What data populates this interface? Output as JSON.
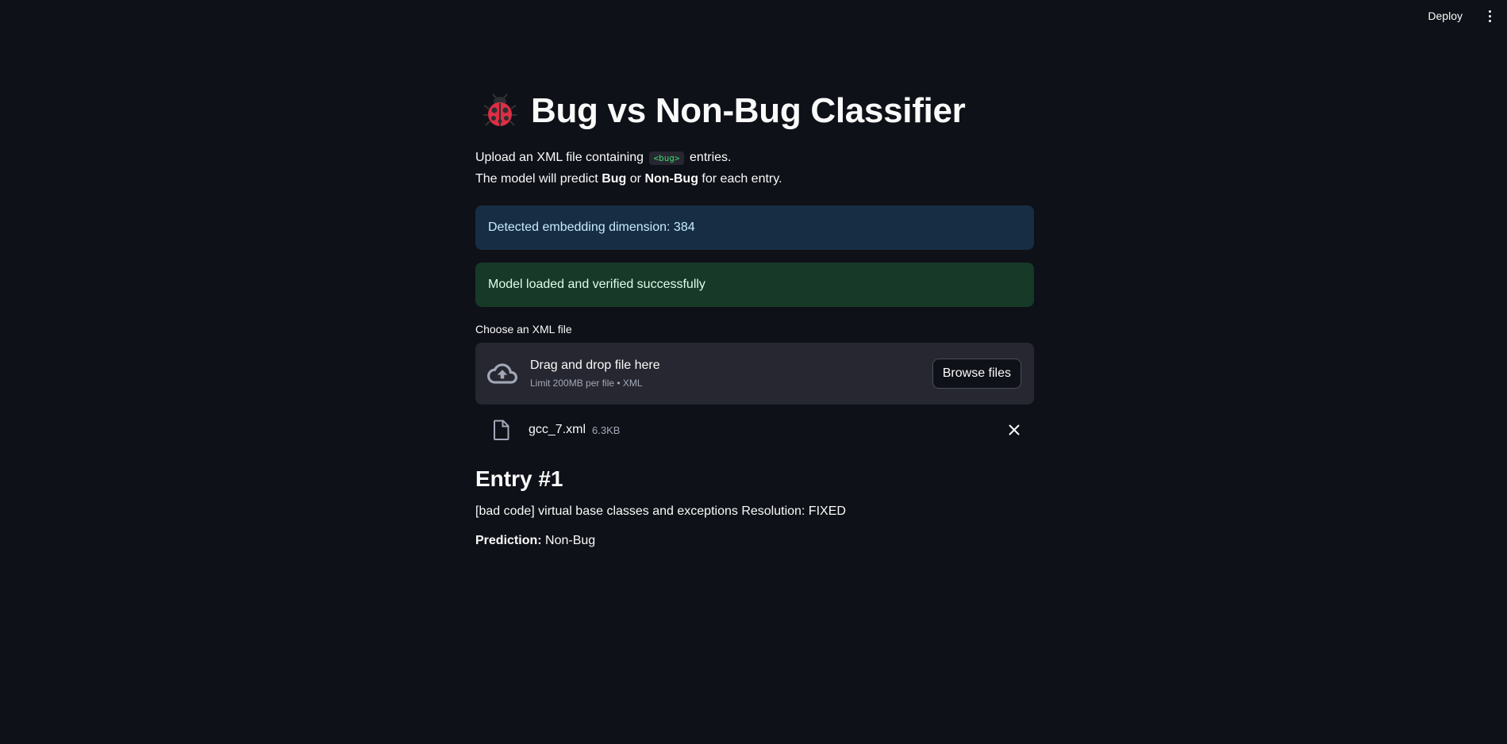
{
  "header": {
    "deploy_label": "Deploy"
  },
  "page": {
    "title": "Bug vs Non-Bug Classifier",
    "intro": {
      "line1_prefix": "Upload an XML file containing",
      "line1_code": "<bug>",
      "line1_suffix": "entries.",
      "line2_prefix": "The model will predict",
      "line2_bold1": "Bug",
      "line2_mid": "or",
      "line2_bold2": "Non-Bug",
      "line2_suffix": "for each entry."
    }
  },
  "alerts": {
    "info": "Detected embedding dimension: 384",
    "success": "Model loaded and verified successfully"
  },
  "uploader": {
    "label": "Choose an XML file",
    "drop_text": "Drag and drop file here",
    "limit_text": "Limit 200MB per file • XML",
    "browse_label": "Browse files",
    "file": {
      "name": "gcc_7.xml",
      "size": "6.3KB"
    }
  },
  "entry": {
    "heading": "Entry #1",
    "text": "[bad code] virtual base classes and exceptions Resolution: FIXED",
    "prediction_label": "Prediction:",
    "prediction_value": "Non-Bug"
  },
  "colors": {
    "background": "#0e1117",
    "info_bg": "#172d43",
    "success_bg": "#173928",
    "dropzone_bg": "#262730",
    "code_color": "#3dd56d"
  }
}
